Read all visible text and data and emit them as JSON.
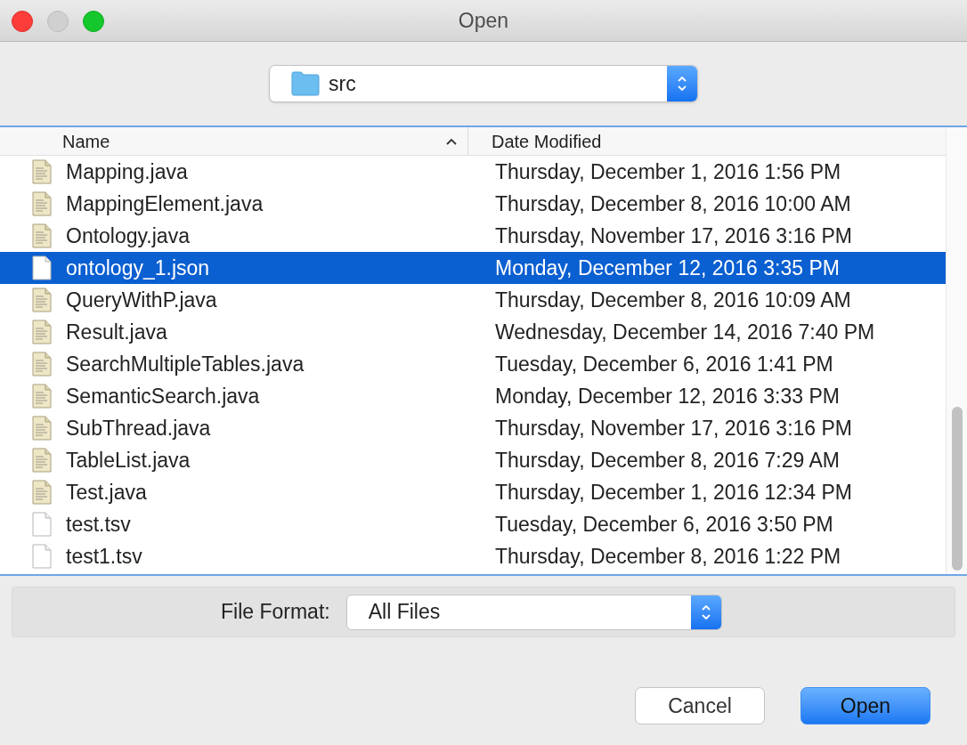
{
  "window": {
    "title": "Open"
  },
  "location": {
    "value": "src"
  },
  "table": {
    "columns": [
      {
        "label": "Name",
        "sorted": true
      },
      {
        "label": "Date Modified",
        "sorted": false
      }
    ],
    "rows": [
      {
        "kind": "java",
        "name": "Mapping.java",
        "date": "Thursday, December 1, 2016 1:56 PM",
        "selected": false
      },
      {
        "kind": "java",
        "name": "MappingElement.java",
        "date": "Thursday, December 8, 2016 10:00 AM",
        "selected": false
      },
      {
        "kind": "java",
        "name": "Ontology.java",
        "date": "Thursday, November 17, 2016 3:16 PM",
        "selected": false
      },
      {
        "kind": "plain",
        "name": "ontology_1.json",
        "date": "Monday, December 12, 2016 3:35 PM",
        "selected": true
      },
      {
        "kind": "java",
        "name": "QueryWithP.java",
        "date": "Thursday, December 8, 2016 10:09 AM",
        "selected": false
      },
      {
        "kind": "java",
        "name": "Result.java",
        "date": "Wednesday, December 14, 2016 7:40 PM",
        "selected": false
      },
      {
        "kind": "java",
        "name": "SearchMultipleTables.java",
        "date": "Tuesday, December 6, 2016 1:41 PM",
        "selected": false
      },
      {
        "kind": "java",
        "name": "SemanticSearch.java",
        "date": "Monday, December 12, 2016 3:33 PM",
        "selected": false
      },
      {
        "kind": "java",
        "name": "SubThread.java",
        "date": "Thursday, November 17, 2016 3:16 PM",
        "selected": false
      },
      {
        "kind": "java",
        "name": "TableList.java",
        "date": "Thursday, December 8, 2016 7:29 AM",
        "selected": false
      },
      {
        "kind": "java",
        "name": "Test.java",
        "date": "Thursday, December 1, 2016 12:34 PM",
        "selected": false
      },
      {
        "kind": "plain",
        "name": "test.tsv",
        "date": "Tuesday, December 6, 2016 3:50 PM",
        "selected": false
      },
      {
        "kind": "plain",
        "name": "test1.tsv",
        "date": "Thursday, December 8, 2016 1:22 PM",
        "selected": false
      }
    ]
  },
  "file_format": {
    "label": "File Format:",
    "value": "All Files"
  },
  "buttons": [
    {
      "label": "Cancel",
      "default": false
    },
    {
      "label": "Open",
      "default": true
    }
  ]
}
